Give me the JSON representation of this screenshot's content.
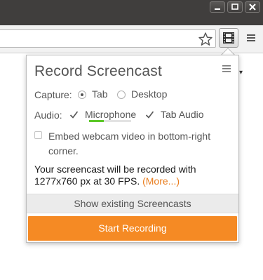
{
  "window": {
    "minimize_icon": "minimize-icon",
    "maximize_icon": "maximize-icon",
    "close_icon": "close-icon"
  },
  "toolbar": {
    "star_icon": "bookmark-star-icon",
    "extension_icon": "film-strip-icon",
    "menu_icon": "hamburger-menu-icon"
  },
  "popup": {
    "title": "Record Screencast",
    "menu_icon": "hamburger-menu-icon",
    "capture": {
      "label": "Capture:",
      "options": [
        "Tab",
        "Desktop"
      ],
      "selected": "Tab"
    },
    "audio": {
      "label": "Audio:",
      "microphone_label": "Microphone",
      "microphone_checked": true,
      "microphone_level": 0.35,
      "tab_audio_label": "Tab Audio",
      "tab_audio_checked": true
    },
    "webcam": {
      "label": "Embed webcam video in bottom-right corner.",
      "checked": false
    },
    "info_text": "Your screencast will be recorded with 1277x760 px at 30 FPS.",
    "more_link": "(More...)",
    "show_button": "Show existing Screencasts",
    "start_button": "Start Recording"
  },
  "colors": {
    "accent": "#f58a24",
    "link": "#e97d1e",
    "level": "#5cc828",
    "titlebar": "#403e3d"
  }
}
